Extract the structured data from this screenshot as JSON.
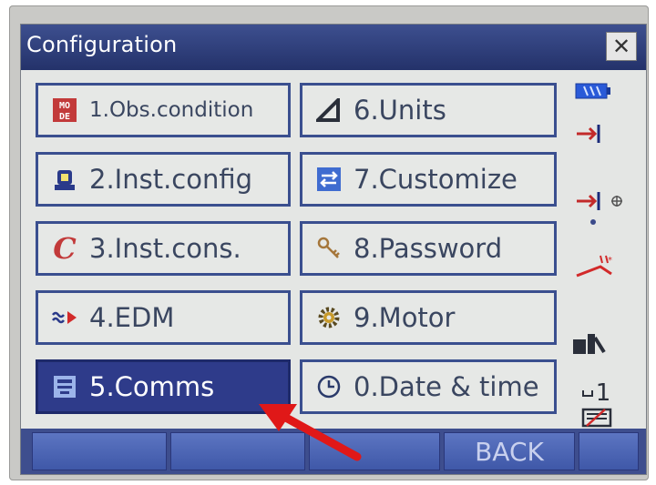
{
  "window": {
    "title": "Configuration",
    "close_icon": "close-icon"
  },
  "menu": [
    {
      "label": "1.Obs.condition",
      "icon": "mode-icon"
    },
    {
      "label": "2.Inst.config",
      "icon": "instrument-icon"
    },
    {
      "label": "3.Inst.cons.",
      "icon": "constant-c-icon"
    },
    {
      "label": "4.EDM",
      "icon": "edm-signal-icon"
    },
    {
      "label": "5.Comms",
      "icon": "comms-icon",
      "selected": true
    },
    {
      "label": "6.Units",
      "icon": "triangle-icon"
    },
    {
      "label": "7.Customize",
      "icon": "swap-arrows-icon"
    },
    {
      "label": "8.Password",
      "icon": "key-icon"
    },
    {
      "label": "9.Motor",
      "icon": "gear-icon"
    },
    {
      "label": "0.Date & time",
      "icon": "clock-icon"
    }
  ],
  "status": {
    "icons": [
      "battery-icon",
      "target-arrow-icon",
      "target-arrow-crosshair-icon",
      "dot-icon",
      "laser-pointer-icon",
      "tilt-icon",
      "face-indicator-icon",
      "keyboard-icon"
    ],
    "face_number": "1"
  },
  "softkeys": [
    "",
    "",
    "",
    "BACK",
    ""
  ],
  "colors": {
    "title_bg": "#2a3870",
    "button_border": "#3a4f8f",
    "selected_bg": "#2e3b8a",
    "softkey_bg": "#4a62b0",
    "arrow": "#e01818"
  }
}
